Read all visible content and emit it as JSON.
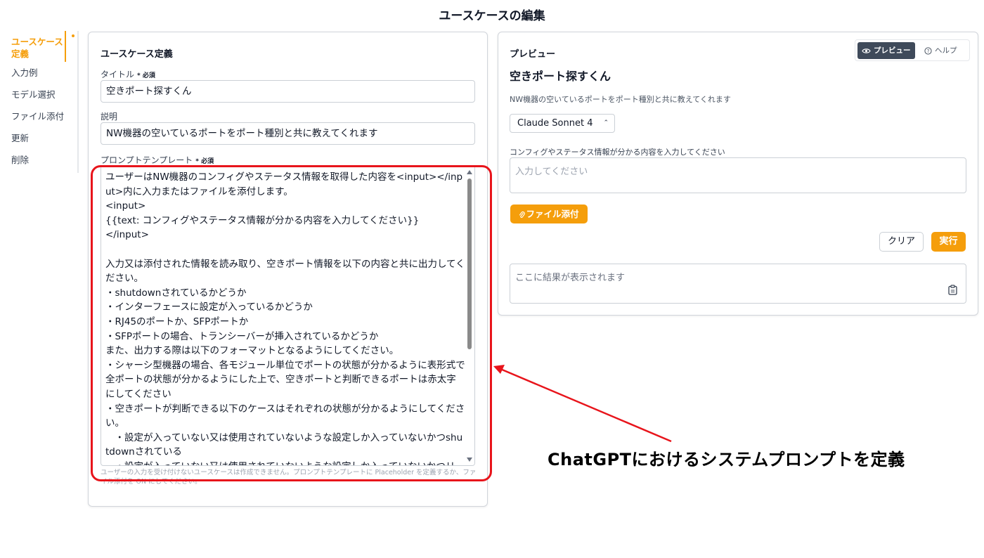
{
  "page": {
    "title": "ユースケースの編集"
  },
  "sidebar": {
    "items": [
      {
        "label": "ユースケース定義"
      },
      {
        "label": "入力例"
      },
      {
        "label": "モデル選択"
      },
      {
        "label": "ファイル添付"
      },
      {
        "label": "更新"
      },
      {
        "label": "削除"
      }
    ]
  },
  "definition": {
    "heading": "ユースケース定義",
    "title_label": "タイトル",
    "required": "* 必須",
    "title_value": "空きポート探すくん",
    "desc_label": "説明",
    "desc_value": "NW機器の空いているポートをポート種別と共に教えてくれます",
    "prompt_label": "プロンプトテンプレート",
    "prompt_value": "ユーザーはNW機器のコンフィグやステータス情報を取得した内容を<input></input>内に入力またはファイルを添付します。\n<input>\n{{text: コンフィグやステータス情報が分かる内容を入力してください}}\n</input>\n\n入力又は添付された情報を読み取り、空きポート情報を以下の内容と共に出力してください。\n・shutdownされているかどうか\n・インターフェースに設定が入っているかどうか\n・RJ45のポートか、SFPポートか\n・SFPポートの場合、トランシーバーが挿入されているかどうか\nまた、出力する際は以下のフォーマットとなるようにしてください。\n・シャーシ型機器の場合、各モジュール単位でポートの状態が分かるように表形式で全ポートの状態が分かるようにした上で、空きポートと判断できるポートは赤太字にしてください\n・空きポートが判断できる以下のケースはそれぞれの状態が分かるようにしてください。\n　・設定が入っていない又は使用されていないような設定しか入っていないかつshutdownされている\n　・設定が入っていない又は使用されていないような設定しか入っていないかつリ",
    "hint": "ユーザーの入力を受け付けないユースケースは作成できません。プロンプトテンプレートに Placeholder を定義するか、ファイル添付を ON にしてください。"
  },
  "preview": {
    "heading": "プレビュー",
    "tabs": {
      "preview": "プレビュー",
      "help": "ヘルプ"
    },
    "name": "空きポート探すくん",
    "description": "NW機器の空いているポートをポート種別と共に教えてくれます",
    "model": "Claude Sonnet 4",
    "input_label": "コンフィグやステータス情報が分かる内容を入力してください",
    "input_placeholder": "入力してください",
    "attach_label": "ファイル添付",
    "clear_label": "クリア",
    "run_label": "実行",
    "result_placeholder": "ここに結果が表示されます"
  },
  "annotation": {
    "text": "ChatGPTにおけるシステムプロンプトを定義"
  },
  "colors": {
    "accent": "#f59e0b",
    "highlight": "#e8141b",
    "tab_active": "#3f4a5a"
  }
}
